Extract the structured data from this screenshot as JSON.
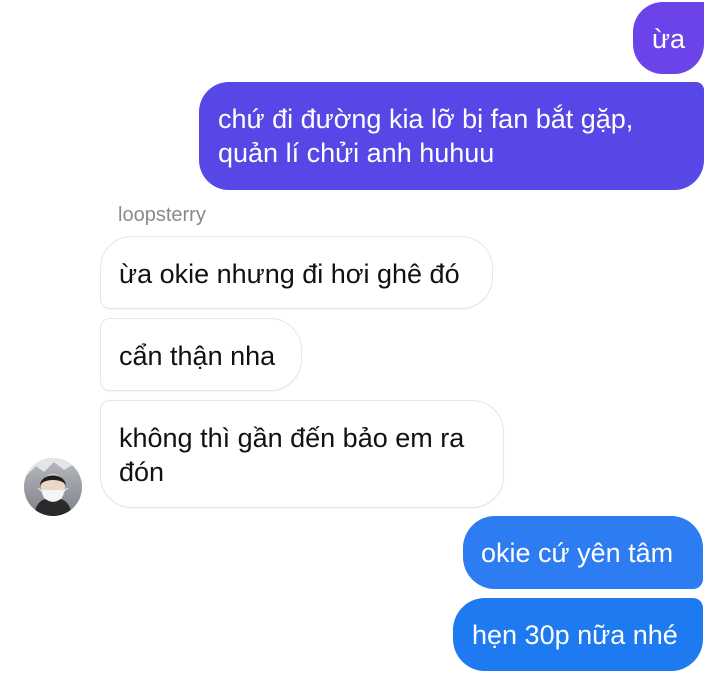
{
  "conversation": {
    "sender_name": "loopsterry",
    "messages": [
      {
        "from": "me",
        "text": "ừa"
      },
      {
        "from": "me",
        "text": "chứ đi đường kia lỡ bị fan bắt gặp, quản lí chửi anh huhuu"
      },
      {
        "from": "other",
        "text": "ừa okie nhưng đi hơi ghê đó"
      },
      {
        "from": "other",
        "text": "cẩn thận nha"
      },
      {
        "from": "other",
        "text": "không thì gần đến bảo em ra đón"
      },
      {
        "from": "me",
        "text": "okie cứ yên tâm"
      },
      {
        "from": "me",
        "text": "hẹn 30p nữa nhé"
      }
    ]
  },
  "colors": {
    "outgoing_purple": "#6b43e8",
    "outgoing_indigo": "#5747e6",
    "outgoing_blue": "#1d7af1",
    "incoming_bg": "#ffffff",
    "sender_name": "#8a8a8a"
  },
  "icons": {
    "avatar": "user-avatar-photo"
  }
}
